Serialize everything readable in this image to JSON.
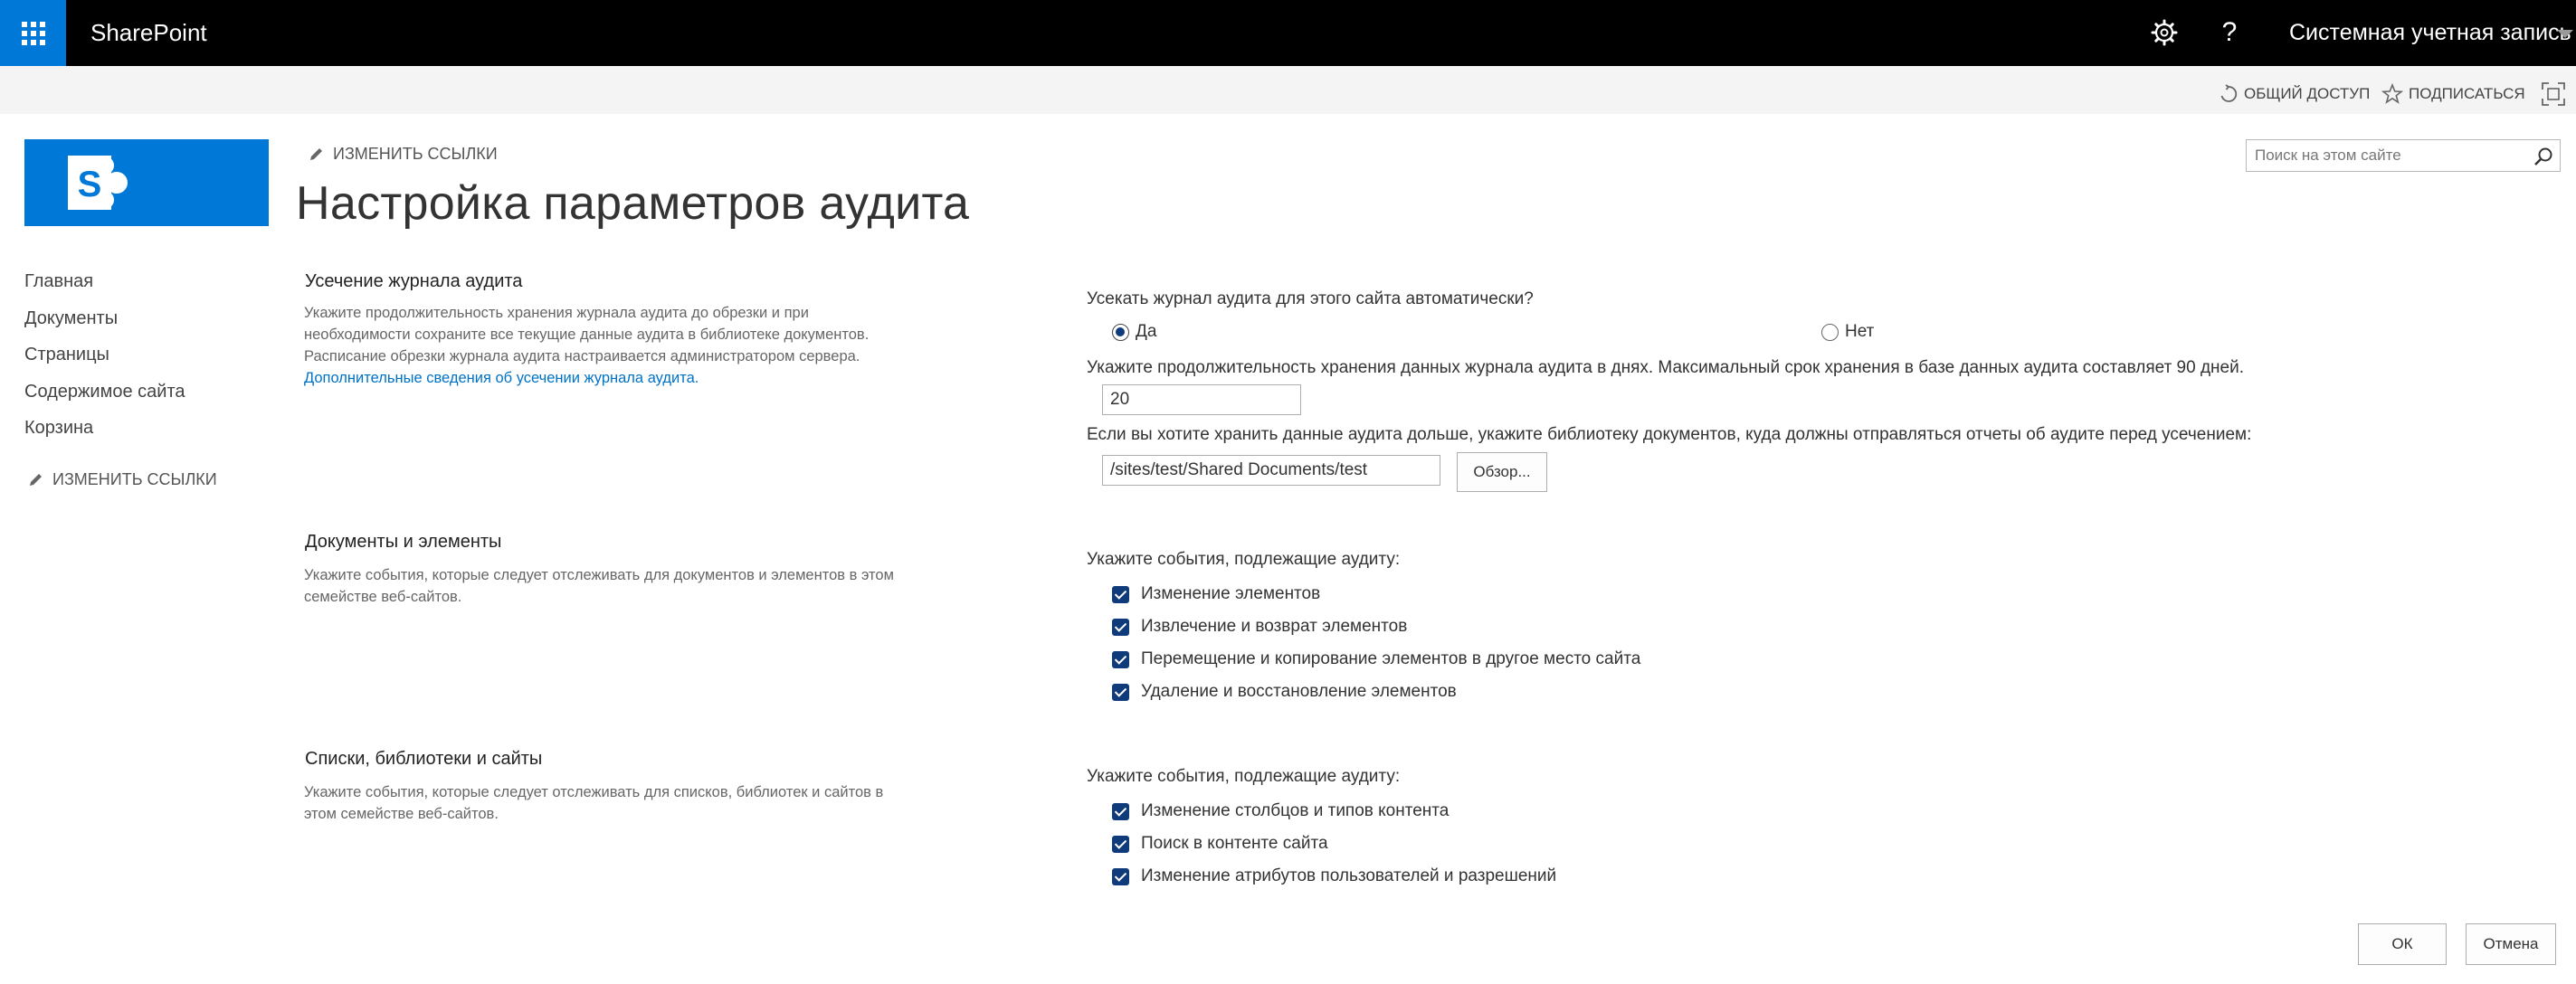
{
  "suite_bar": {
    "app_name": "SharePoint",
    "help_label": "?",
    "account_name": "Системная учетная запись",
    "colors": {
      "bar": "#000000",
      "waffle": "#0078d7"
    }
  },
  "actions": {
    "share_label": "ОБЩИЙ ДОСТУП",
    "follow_label": "ПОДПИСАТЬСЯ"
  },
  "page": {
    "edit_links": "ИЗМЕНИТЬ ССЫЛКИ",
    "title": "Настройка параметров аудита"
  },
  "search": {
    "placeholder": "Поиск на этом сайте"
  },
  "left_nav": {
    "items": [
      "Главная",
      "Документы",
      "Страницы",
      "Содержимое сайта",
      "Корзина"
    ],
    "edit_links": "ИЗМЕНИТЬ ССЫЛКИ"
  },
  "trim_section": {
    "title": "Усечение журнала аудита",
    "desc_lines": [
      "Укажите продолжительность хранения журнала аудита до обрезки и при",
      "необходимости сохраните все текущие данные аудита в библиотеке документов.",
      "Расписание обрезки журнала аудита настраивается администратором сервера."
    ],
    "more_link": "Дополнительные сведения об усечении журнала аудита.",
    "question": "Усекать журнал аудита для этого сайта автоматически?",
    "option_yes": "Да",
    "option_no": "Нет",
    "selected": "Да",
    "days_label": "Укажите продолжительность хранения данных журнала аудита в днях. Максимальный срок хранения в базе данных аудита составляет 90 дней.",
    "days_value": "20",
    "library_label": "Если вы хотите хранить данные аудита дольше, укажите библиотеку документов, куда должны отправляться отчеты об аудите перед усечением:",
    "library_value": "/sites/test/Shared Documents/test",
    "browse_label": "Обзор..."
  },
  "docs_section": {
    "title": "Документы и элементы",
    "desc_lines": [
      "Укажите события, которые следует отслеживать для документов и элементов в этом",
      "семействе веб-сайтов."
    ],
    "events_label": "Укажите события, подлежащие аудиту:",
    "events": [
      "Изменение элементов",
      "Извлечение и возврат элементов",
      "Перемещение и копирование элементов в другое место сайта",
      "Удаление и восстановление элементов"
    ]
  },
  "lists_section": {
    "title": "Списки, библиотеки и сайты",
    "desc_lines": [
      "Укажите события, которые следует отслеживать для списков, библиотек и сайтов в",
      "этом семействе веб-сайтов."
    ],
    "events_label": "Укажите события, подлежащие аудиту:",
    "events": [
      "Изменение столбцов и типов контента",
      "Поиск в контенте сайта",
      "Изменение атрибутов пользователей и разрешений"
    ]
  },
  "footer": {
    "ok_label": "ОК",
    "cancel_label": "Отмена"
  }
}
